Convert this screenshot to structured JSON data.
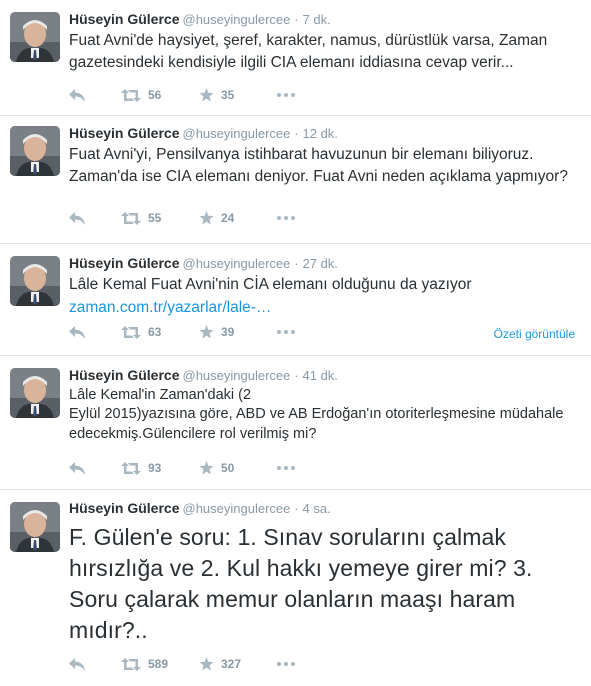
{
  "colors": {
    "link": "#1b95e0",
    "muted": "#8899a6",
    "text": "#292f33",
    "divider": "#e1e8ed"
  },
  "icons": {
    "reply": "reply-icon",
    "retweet": "retweet-icon",
    "favorite": "star-icon",
    "more": "more-dots-icon"
  },
  "tweets": [
    {
      "fullname": "Hüseyin Gülerce",
      "username": "@huseyingulercee",
      "separator": "·",
      "time": "7 dk.",
      "text": "Fuat Avni'de haysiyet, şeref, karakter, namus, dürüstlük varsa, Zaman gazetesindeki kendisiyle ilgili CIA elemanı iddiasına cevap verir...",
      "retweets": "56",
      "favorites": "35"
    },
    {
      "fullname": "Hüseyin Gülerce",
      "username": "@huseyingulercee",
      "separator": "·",
      "time": "12 dk.",
      "text": "Fuat Avni'yi, Pensilvanya istihbarat havuzunun bir elemanı biliyoruz. Zaman'da ise CIA elemanı deniyor. Fuat Avni neden açıklama yapmıyor?",
      "retweets": "55",
      "favorites": "24"
    },
    {
      "fullname": "Hüseyin Gülerce",
      "username": "@huseyingulercee",
      "separator": "·",
      "time": "27 dk.",
      "text": "Lâle Kemal Fuat Avni'nin CİA elemanı olduğunu da yazıyor",
      "link": "zaman.com.tr/yazarlar/lale-…",
      "summary": "Özeti görüntüle",
      "retweets": "63",
      "favorites": "39"
    },
    {
      "fullname": "Hüseyin Gülerce",
      "username": "@huseyingulercee",
      "separator": "·",
      "time": "41 dk.",
      "text_line1": "Lâle Kemal'in Zaman'daki (2",
      "text_line2": "Eylül 2015)yazısına göre, ABD ve AB Erdoğan'ın otoriterleşmesine müdahale edecekmiş.Gülencilere rol verilmiş mi?",
      "retweets": "93",
      "favorites": "50"
    },
    {
      "fullname": "Hüseyin Gülerce",
      "username": "@huseyingulercee",
      "separator": "·",
      "time": "4 sa.",
      "text": "F. Gülen'e soru: 1. Sınav sorularını çalmak hırsızlığa ve 2. Kul hakkı yemeye girer mi? 3. Soru çalarak memur olanların maaşı haram mıdır?..",
      "retweets": "589",
      "favorites": "327"
    }
  ]
}
